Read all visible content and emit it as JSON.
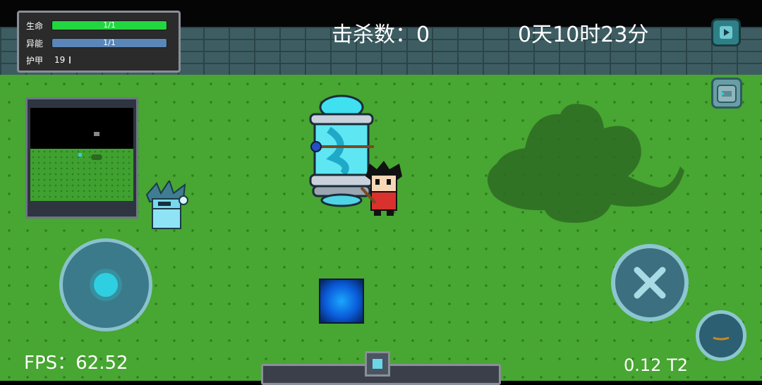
{
  "hud": {
    "health": {
      "label": "生命",
      "value_text": "1/1",
      "fraction": 1.0,
      "color": "#22d640"
    },
    "energy": {
      "label": "异能",
      "value_text": "1/1",
      "fraction": 1.0,
      "color": "#5a86b8"
    },
    "armor": {
      "label": "护甲",
      "value": "19"
    },
    "kills": "击杀数：0",
    "game_time": "0天10时23分",
    "fps": "FPS：62.52",
    "version": "0.12 T2"
  },
  "colors": {
    "grass": "#48a632",
    "wall": "#3e5d62",
    "health_fill": "#22d640",
    "energy_fill": "#5a86b8",
    "portal": "#1aa7ff"
  },
  "icons": {
    "pause": "play-triangle-icon",
    "backpack": "backpack-icon",
    "attack": "crossed-swords-icon",
    "skill": "skill-icon"
  }
}
